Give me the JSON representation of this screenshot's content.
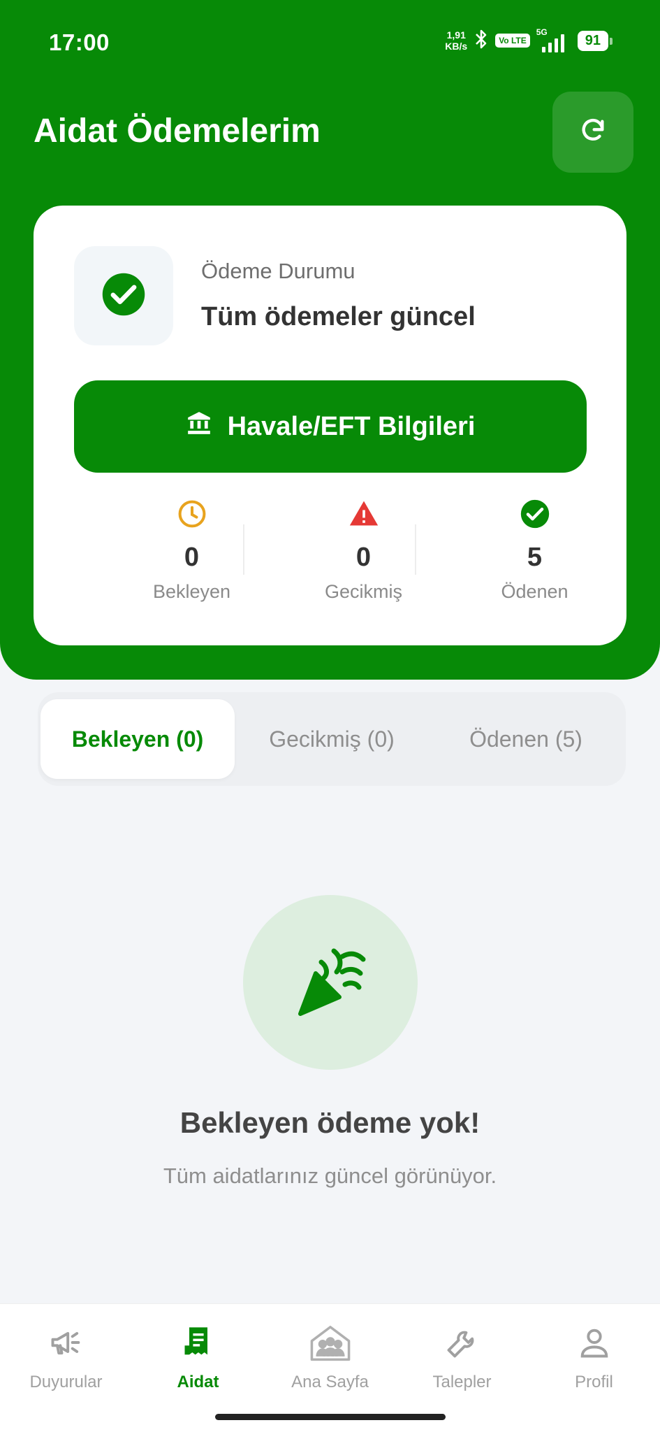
{
  "status_bar": {
    "time": "17:00",
    "speed_value": "1,91",
    "speed_unit": "KB/s",
    "volte": "Vo LTE",
    "network": "5G",
    "battery": "91"
  },
  "header": {
    "title": "Aidat Ödemelerim",
    "refresh_icon": "refresh-icon"
  },
  "payment_card": {
    "status_label": "Ödeme Durumu",
    "status_value": "Tüm ödemeler güncel",
    "eft_button_label": "Havale/EFT Bilgileri",
    "stats": [
      {
        "icon": "clock-icon",
        "value": "0",
        "label": "Bekleyen",
        "color": "#E8A31E"
      },
      {
        "icon": "warning-icon",
        "value": "0",
        "label": "Gecikmiş",
        "color": "#E53935"
      },
      {
        "icon": "check-circle-icon",
        "value": "5",
        "label": "Ödenen",
        "color": "#078A07"
      }
    ]
  },
  "tabs": [
    {
      "label": "Bekleyen (0)",
      "active": true
    },
    {
      "label": "Gecikmiş (0)",
      "active": false
    },
    {
      "label": "Ödenen (5)",
      "active": false
    }
  ],
  "empty_state": {
    "icon": "party-popper-icon",
    "title": "Bekleyen ödeme yok!",
    "subtitle": "Tüm aidatlarınız güncel görünüyor."
  },
  "bottom_nav": [
    {
      "icon": "megaphone-icon",
      "label": "Duyurular",
      "active": false
    },
    {
      "icon": "receipt-icon",
      "label": "Aidat",
      "active": true
    },
    {
      "icon": "community-home-icon",
      "label": "Ana Sayfa",
      "active": false
    },
    {
      "icon": "wrench-icon",
      "label": "Talepler",
      "active": false
    },
    {
      "icon": "person-icon",
      "label": "Profil",
      "active": false
    }
  ],
  "colors": {
    "brand_green": "#078A07",
    "pending": "#E8A31E",
    "overdue": "#E53935",
    "background": "#F3F5F8"
  }
}
